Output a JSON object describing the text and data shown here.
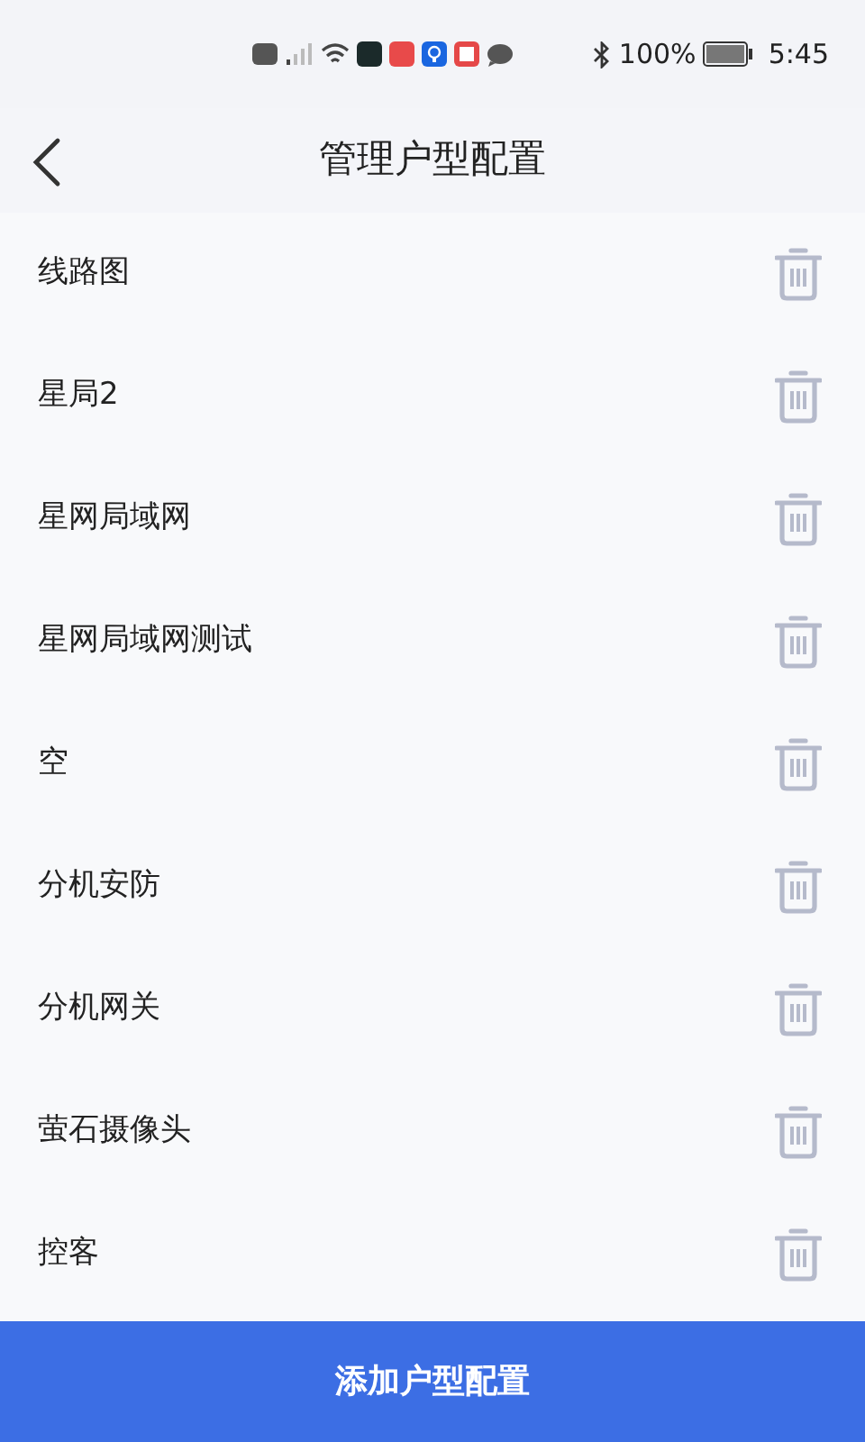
{
  "status_bar": {
    "battery": "100%",
    "time": "5:45"
  },
  "header": {
    "title": "管理户型配置"
  },
  "items": [
    {
      "name": "线路图"
    },
    {
      "name": "星局2"
    },
    {
      "name": "星网局域网"
    },
    {
      "name": "星网局域网测试"
    },
    {
      "name": "空"
    },
    {
      "name": "分机安防"
    },
    {
      "name": "分机网关"
    },
    {
      "name": "萤石摄像头"
    },
    {
      "name": "控客"
    }
  ],
  "add_button": {
    "label": "添加户型配置"
  }
}
